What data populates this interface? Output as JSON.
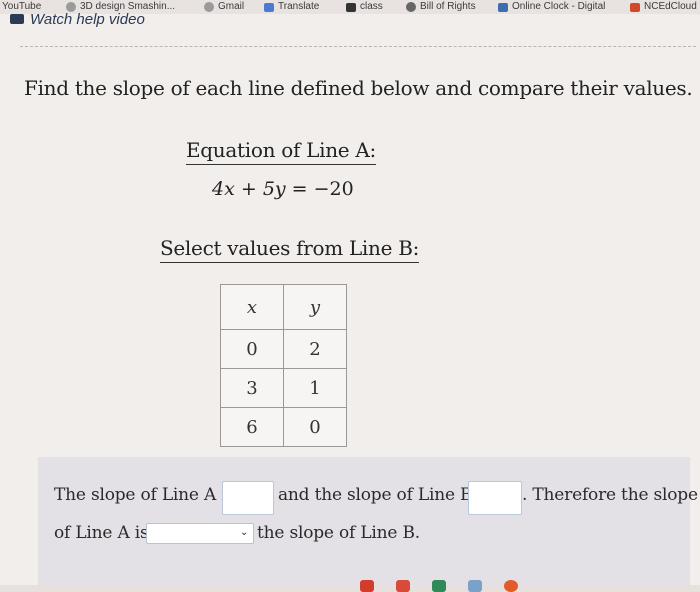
{
  "bookmarks": [
    {
      "label": "YouTube",
      "color": "#c7c2bf"
    },
    {
      "label": "3D design Smashin...",
      "color": "#7a7a7a"
    },
    {
      "label": "Gmail",
      "color": "#7a7a7a"
    },
    {
      "label": "Translate",
      "color": "#4a7bd0"
    },
    {
      "label": "class",
      "color": "#333333"
    },
    {
      "label": "Bill of Rights",
      "color": "#555555"
    },
    {
      "label": "Online Clock - Digital",
      "color": "#3b6fb0"
    },
    {
      "label": "NCEdCloud",
      "color": "#d04a2a"
    }
  ],
  "header": {
    "watch_label": "Watch help video"
  },
  "question": {
    "prompt": "Find the slope of each line defined below and compare their values.",
    "line_a_heading": "Equation of Line A:",
    "equation": {
      "lhs1": "4x",
      "op1": " + ",
      "lhs2": "5y",
      "eq": " = ",
      "rhs": "−20"
    },
    "line_b_heading": "Select values from Line B:",
    "table": {
      "headers": [
        "x",
        "y"
      ],
      "rows": [
        [
          "0",
          "2"
        ],
        [
          "3",
          "1"
        ],
        [
          "6",
          "0"
        ]
      ]
    }
  },
  "answer": {
    "part1": "The slope of Line A is",
    "part2": "and the slope of Line B is",
    "part3": ". Therefore the slope",
    "part4": "of Line A is",
    "part5": "the slope of Line B.",
    "slope_a_value": "",
    "slope_b_value": "",
    "comparison_selected": ""
  },
  "dock_colors": [
    "#d23c2c",
    "#d84a3a",
    "#2f8a57",
    "#7aa2c8",
    "#e25b2a"
  ]
}
